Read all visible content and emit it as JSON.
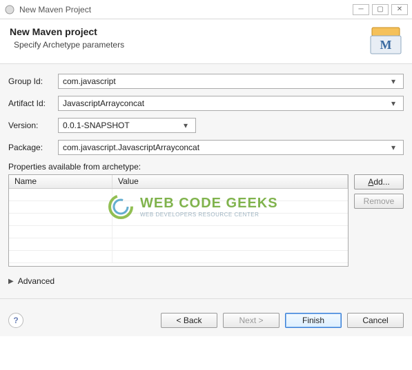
{
  "window": {
    "title": "New Maven Project"
  },
  "header": {
    "title": "New Maven project",
    "subtitle": "Specify Archetype parameters"
  },
  "form": {
    "groupId": {
      "label": "Group Id:",
      "value": "com.javascript"
    },
    "artifactId": {
      "label": "Artifact Id:",
      "value": "JavascriptArrayconcat"
    },
    "version": {
      "label": "Version:",
      "value": "0.0.1-SNAPSHOT"
    },
    "package": {
      "label": "Package:",
      "value": "com.javascript.JavascriptArrayconcat"
    }
  },
  "properties": {
    "sectionLabel": "Properties available from archetype:",
    "columns": {
      "name": "Name",
      "value": "Value"
    },
    "addLabel": "Add...",
    "removeLabel": "Remove"
  },
  "advanced": {
    "label": "Advanced"
  },
  "footer": {
    "back": "< Back",
    "next": "Next >",
    "finish": "Finish",
    "cancel": "Cancel"
  },
  "watermark": {
    "main": "WEB CODE GEEKS",
    "sub": "WEB DEVELOPERS RESOURCE CENTER"
  }
}
